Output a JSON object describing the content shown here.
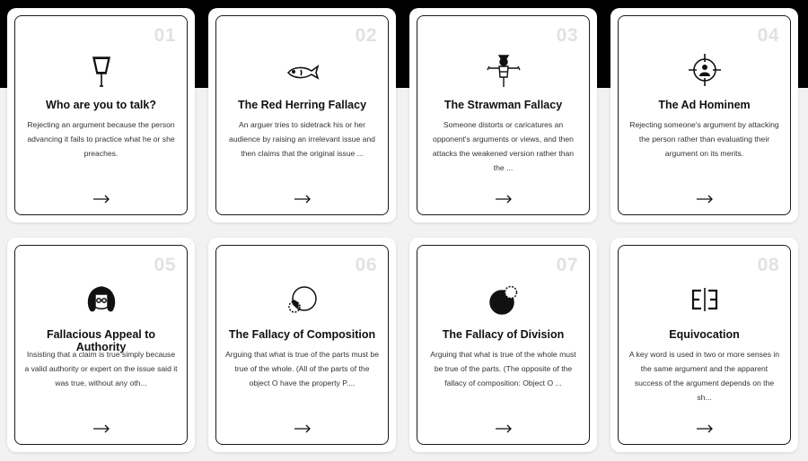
{
  "cards": [
    {
      "num": "01",
      "icon": "megaphone-icon",
      "title": "Who are you to talk?",
      "desc": "Rejecting an argument because the person advancing it fails to practice what he or she preaches."
    },
    {
      "num": "02",
      "icon": "red-herring-fish-icon",
      "title": "The Red Herring Fallacy",
      "desc": "An arguer tries to sidetrack his or her audience by raising an irrelevant issue and then claims that the original issue ..."
    },
    {
      "num": "03",
      "icon": "scarecrow-icon",
      "title": "The Strawman Fallacy",
      "desc": "Someone distorts or caricatures an opponent's arguments or views, and then attacks the weakened version rather than the ..."
    },
    {
      "num": "04",
      "icon": "crosshair-person-icon",
      "title": "The Ad Hominem",
      "desc": "Rejecting someone's argument by attacking the person rather than evaluating their argument on its merits."
    },
    {
      "num": "05",
      "icon": "judge-wig-icon",
      "title": "Fallacious Appeal to Authority",
      "desc": "Insisting that a claim is true simply because a valid authority or expert on the issue said it was true, without any oth..."
    },
    {
      "num": "06",
      "icon": "circle-parts-icon",
      "title": "The Fallacy of Composition",
      "desc": "Arguing that what is true of the parts must be true of the whole. (All of the parts of the object O have the property P...."
    },
    {
      "num": "07",
      "icon": "whole-to-part-icon",
      "title": "The Fallacy of Division",
      "desc": "Arguing that what is true of the whole must be true of the parts. (The opposite of the fallacy of composition: Object O ..."
    },
    {
      "num": "08",
      "icon": "mirrored-e-icon",
      "title": "Equivocation",
      "desc": "A key word is used in two or more senses in the same argument and the apparent success of the argument depends on the sh..."
    }
  ],
  "arrow_icon": "arrow-right-icon",
  "colors": {
    "band": "#000000",
    "background": "#f2f2f2",
    "number": "#e2e2e2"
  }
}
